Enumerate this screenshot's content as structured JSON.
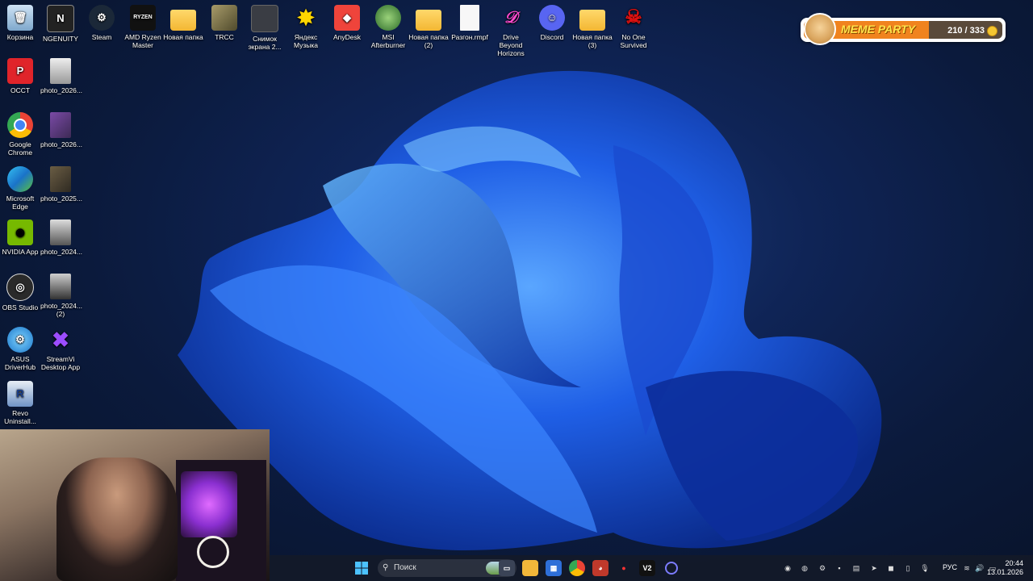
{
  "desktop": {
    "top_row": [
      {
        "label": "Корзина",
        "icon": "recycle-bin-icon"
      },
      {
        "label": "NGENUITY",
        "icon": "ngenuity-icon"
      },
      {
        "label": "Steam",
        "icon": "steam-icon"
      },
      {
        "label": "AMD Ryzen Master",
        "icon": "ryzen-master-icon"
      },
      {
        "label": "Новая папка",
        "icon": "folder-icon"
      },
      {
        "label": "TRCC",
        "icon": "trcc-icon"
      },
      {
        "label": "Снимок экрана 2...",
        "icon": "screenshot-icon"
      },
      {
        "label": "Яндекс Музыка",
        "icon": "yandex-music-icon"
      },
      {
        "label": "AnyDesk",
        "icon": "anydesk-icon"
      },
      {
        "label": "MSI Afterburner",
        "icon": "msi-afterburner-icon"
      },
      {
        "label": "Новая папка (2)",
        "icon": "folder-icon"
      },
      {
        "label": "Разгон.rmpf",
        "icon": "file-icon"
      },
      {
        "label": "Drive Beyond Horizons",
        "icon": "drive-beyond-horizons-icon"
      },
      {
        "label": "Discord",
        "icon": "discord-icon"
      },
      {
        "label": "Новая папка (3)",
        "icon": "folder-icon"
      },
      {
        "label": "No One Survived",
        "icon": "no-one-survived-icon"
      }
    ],
    "left_col": [
      {
        "label": "OCCT",
        "icon": "occt-icon"
      },
      {
        "label": "Google Chrome",
        "icon": "chrome-icon"
      },
      {
        "label": "Microsoft Edge",
        "icon": "edge-icon"
      },
      {
        "label": "NVIDIA App",
        "icon": "nvidia-icon"
      },
      {
        "label": "OBS Studio",
        "icon": "obs-icon"
      },
      {
        "label": "ASUS DriverHub",
        "icon": "asus-driverhub-icon"
      },
      {
        "label": "Revo Uninstall...",
        "icon": "revo-uninstaller-icon"
      }
    ],
    "second_col": [
      {
        "label": "photo_2026...",
        "icon": "photo-thumbnail-icon"
      },
      {
        "label": "photo_2026...",
        "icon": "photo-thumbnail-icon"
      },
      {
        "label": "photo_2025...",
        "icon": "photo-thumbnail-icon"
      },
      {
        "label": "photo_2024...",
        "icon": "photo-thumbnail-icon"
      },
      {
        "label": "photo_2024... (2)",
        "icon": "photo-thumbnail-icon"
      },
      {
        "label": "StreamVi Desktop App",
        "icon": "streamvi-icon"
      }
    ]
  },
  "meme_party": {
    "title": "MEME PARTY",
    "count": "210 / 333",
    "progress": 0.63,
    "colors": {
      "fill": "#f0831e",
      "title": "#ffe24a"
    }
  },
  "taskbar": {
    "search_placeholder": "Поиск",
    "language": "РУС",
    "time": "20:44",
    "date": "13.01.2026",
    "apps": [
      "start-icon",
      "search-icon",
      "task-view-icon",
      "file-explorer-icon",
      "store-icon",
      "chrome-icon",
      "browser-icon",
      "recorder-icon",
      "v2-icon",
      "cortana-icon"
    ],
    "v2_label": "V2"
  }
}
